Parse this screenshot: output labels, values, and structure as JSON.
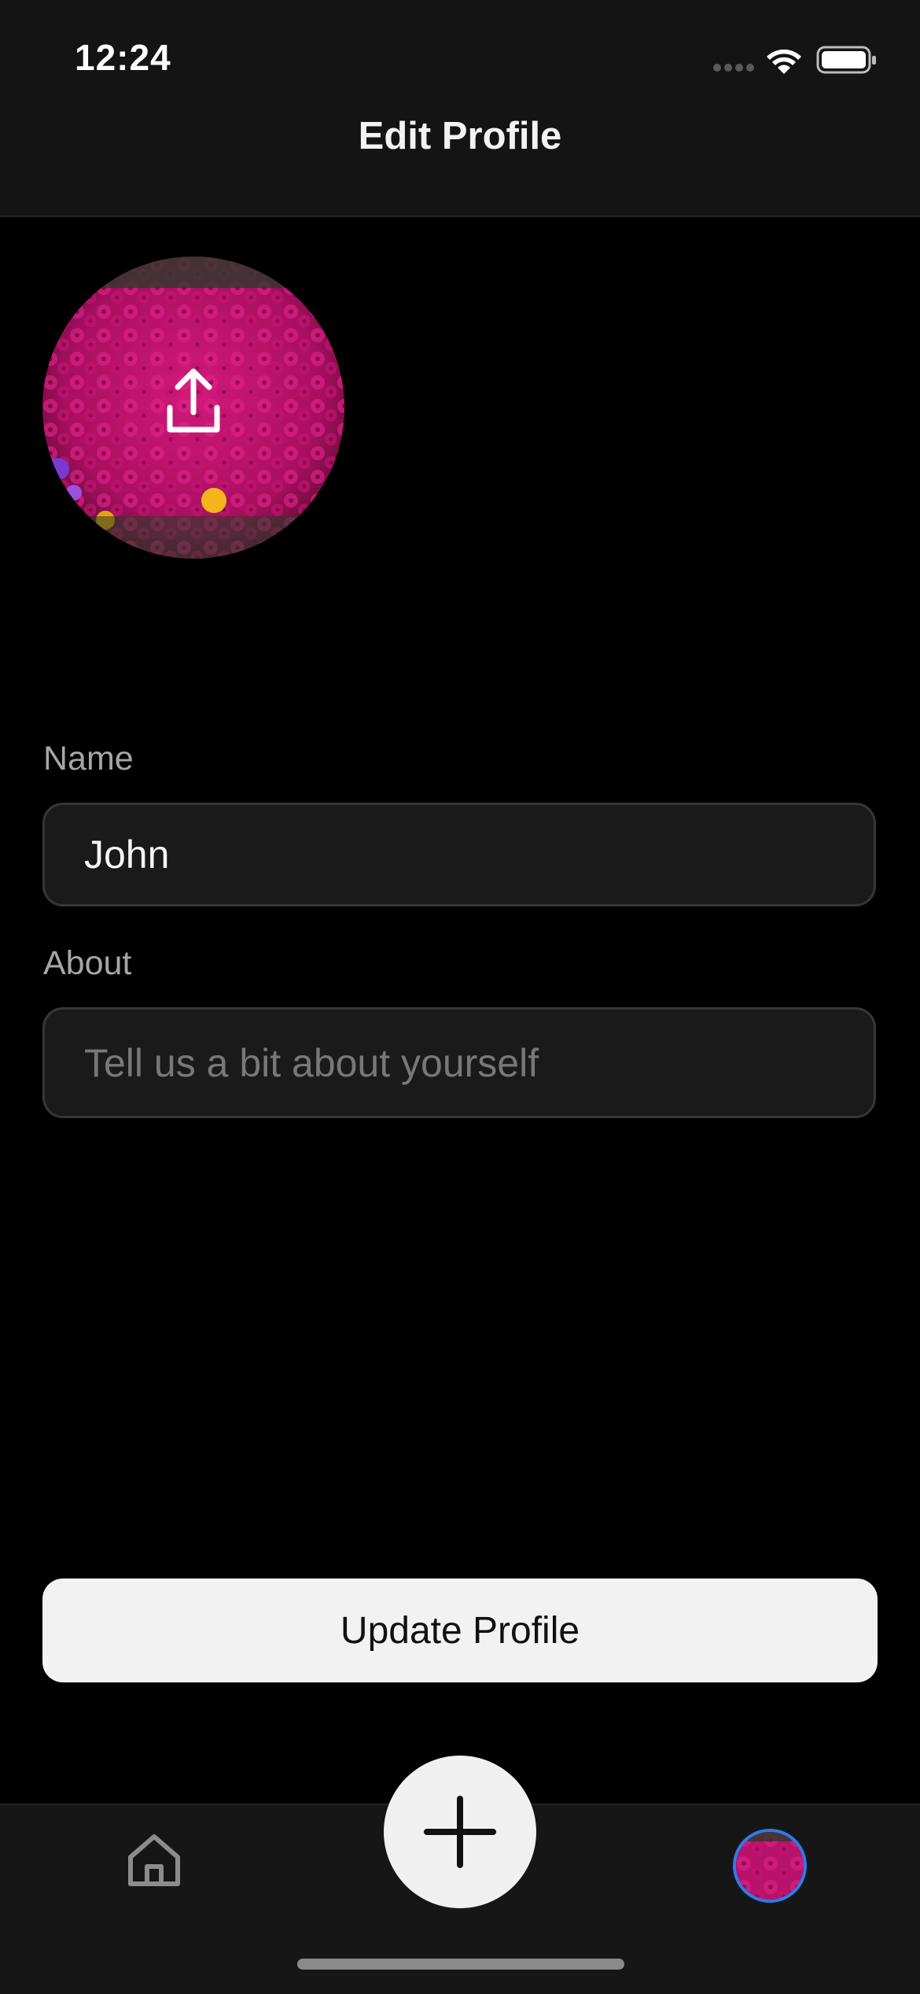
{
  "status_bar": {
    "time": "12:24",
    "icons": [
      "signal-icon",
      "wifi-icon",
      "battery-icon"
    ]
  },
  "header": {
    "title": "Edit Profile"
  },
  "avatar": {
    "icon": "upload-icon"
  },
  "form": {
    "name_label": "Name",
    "name_value": "John",
    "about_label": "About",
    "about_placeholder": "Tell us a bit about yourself"
  },
  "actions": {
    "update_label": "Update Profile"
  },
  "tab_bar": {
    "items": [
      "home-icon",
      "plus-icon",
      "profile-avatar"
    ],
    "accent": "#2b7de9"
  },
  "colors": {
    "background": "#000000",
    "surface": "#141414",
    "field": "#1a1a1a",
    "button": "#f2f2f2",
    "flower": "#c0146e"
  }
}
